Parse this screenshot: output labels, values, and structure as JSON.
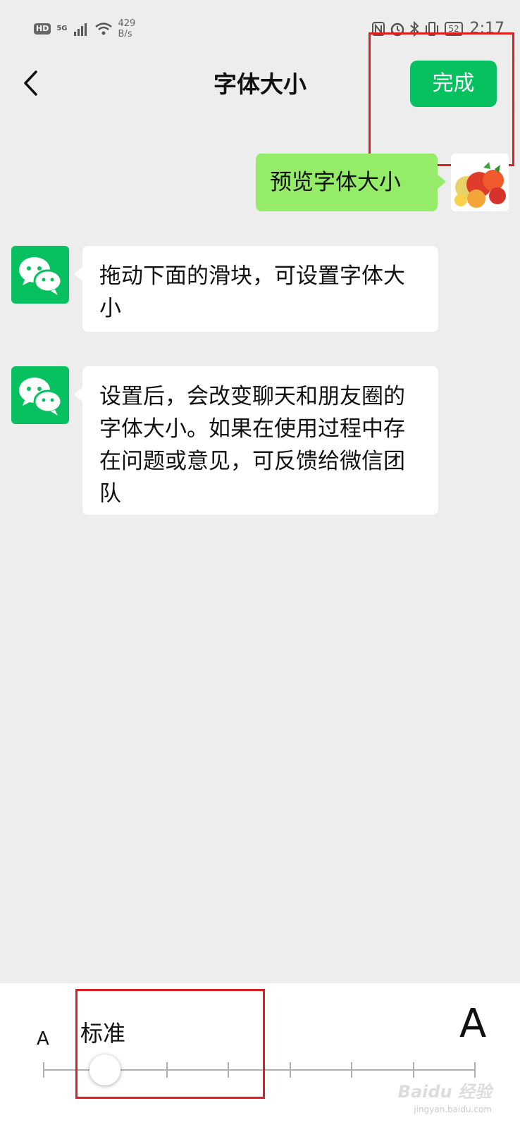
{
  "status_bar": {
    "hd": "HD",
    "network": "5G",
    "speed_value": "429",
    "speed_unit": "B/s",
    "battery": "52",
    "time": "2:17"
  },
  "header": {
    "title": "字体大小",
    "done_label": "完成"
  },
  "messages": [
    {
      "from": "self",
      "text": "预览字体大小"
    },
    {
      "from": "app",
      "text": "拖动下面的滑块，可设置字体大小"
    },
    {
      "from": "app",
      "text": "设置后，会改变聊天和朋友圈的字体大小。如果在使用过程中存在问题或意见，可反馈给微信团队"
    }
  ],
  "font_slider": {
    "small_label": "A",
    "large_label": "A",
    "current_label": "标准",
    "level": 1,
    "max_level": 7
  },
  "watermark": {
    "text": "Baidu 经验",
    "sub": "jingyan.baidu.com"
  },
  "colors": {
    "accent": "#07c160",
    "self_bubble": "#95ec69",
    "background": "#ededed",
    "highlight": "#e02020"
  }
}
